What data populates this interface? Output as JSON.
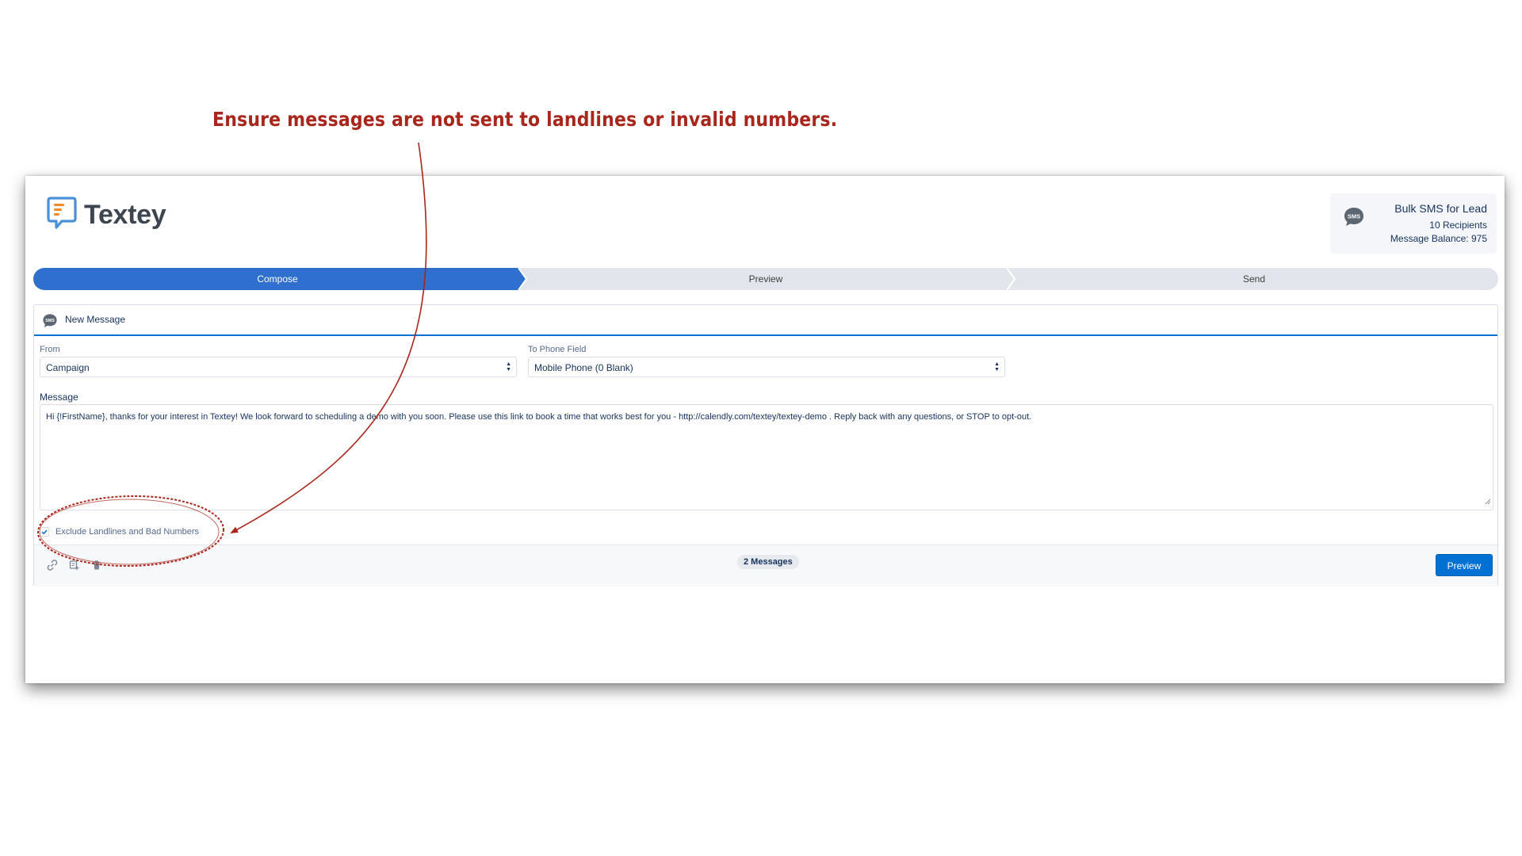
{
  "annotation": {
    "text": "Ensure messages are not sent to landlines or invalid numbers.",
    "color": "#a8261c"
  },
  "app": {
    "logo_text": "Textey",
    "logo_icon": "speech-bubble-icon"
  },
  "info_card": {
    "icon": "sms-bubble-icon",
    "title": "Bulk SMS for Lead",
    "recipients": "10 Recipients",
    "balance": "Message Balance: 975"
  },
  "path": {
    "steps": [
      {
        "label": "Compose",
        "active": true
      },
      {
        "label": "Preview",
        "active": false
      },
      {
        "label": "Send",
        "active": false
      }
    ],
    "active_color": "#2f6fce",
    "inactive_color": "#e2e6ec"
  },
  "card": {
    "title": "New Message",
    "from_label": "From",
    "from_value": "Campaign",
    "to_label": "To Phone Field",
    "to_value": "Mobile Phone (0 Blank)",
    "message_label": "Message",
    "message_value": "Hi {!FirstName}, thanks for your interest in Textey! We look forward to scheduling a demo with you soon. Please use this link to book a time that works best for you - http://calendly.com/textey/textey-demo . Reply back with any questions, or STOP to opt-out.",
    "exclude_label": "Exclude Landlines and Bad Numbers",
    "exclude_checked": true,
    "footer_icons": [
      "link-icon",
      "template-icon",
      "trash-icon"
    ],
    "message_count": "2 Messages",
    "preview_button": "Preview"
  }
}
